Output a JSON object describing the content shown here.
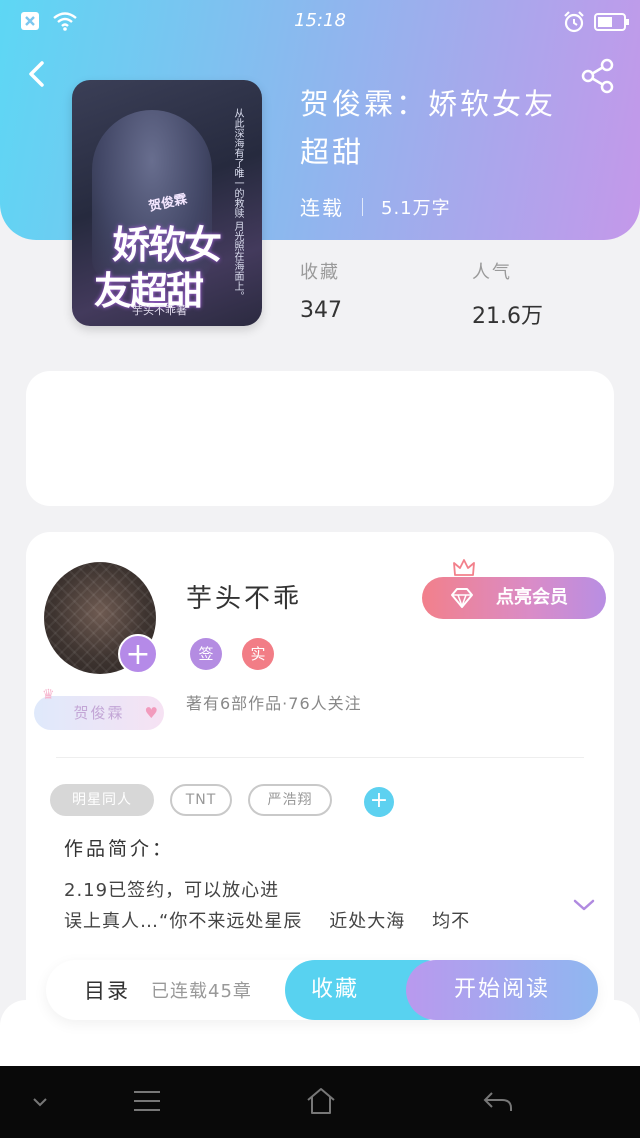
{
  "status_bar": {
    "time": "15:18",
    "icons": [
      "app-notification-icon",
      "wifi-icon",
      "alarm-icon",
      "battery-icon"
    ]
  },
  "header": {
    "back_icon": "chevron-left-icon",
    "share_icon": "share-icon"
  },
  "book": {
    "title": "贺俊霖：娇软女友超甜",
    "status": "连载",
    "word_count": "5.1万字",
    "cover": {
      "tag": "贺俊霖",
      "title_line1": "娇软女",
      "title_line2": "友超甜",
      "tagline": "从此深海有了唯一的救赎 月光照在海面上。",
      "author": "芋头不乖著"
    }
  },
  "stats": {
    "favorites_label": "收藏",
    "favorites_value": "347",
    "popularity_label": "人气",
    "popularity_value": "21.6万"
  },
  "author": {
    "name": "芋头不乖",
    "badge_sign": "签",
    "badge_real": "实",
    "stats": "著有6部作品·76人关注",
    "fan_badge": "贺俊霖",
    "follow_icon": "plus-icon",
    "vip_button": "点亮会员"
  },
  "tags": [
    "明星同人",
    "TNT",
    "严浩翔"
  ],
  "intro": {
    "title": "作品简介：",
    "text": "2.19已签约，可以放心进\n误上真人…“你不来远处星辰    近处大海    均不"
  },
  "bottom_bar": {
    "toc_label": "目录",
    "toc_count": "已连载45章",
    "favorite_button": "收藏",
    "read_button": "开始阅读"
  },
  "colors": {
    "header_gradient_start": "#5dd7f4",
    "header_gradient_end": "#c498ea",
    "favorite_button": "#58d2f0",
    "read_button_start": "#b999ee",
    "vip_start": "#f2808b",
    "vip_end": "#b88ee3"
  }
}
